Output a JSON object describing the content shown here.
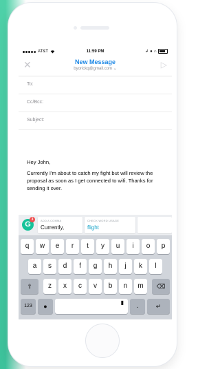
{
  "status_bar": {
    "carrier": "AT&T",
    "time": "11:59 PM"
  },
  "nav": {
    "title": "New Message",
    "from": "byorickq@gmail.com"
  },
  "fields": [
    {
      "label": "To:"
    },
    {
      "label": "Cc/Bcc:"
    },
    {
      "label": "Subject:"
    }
  ],
  "body": {
    "greeting": "Hey John,",
    "text": "Currently I'm about to catch my fight but will review the proposal as soon as I get connected to wifi. Thanks for sending it over."
  },
  "grammarly": {
    "badge_count": "3",
    "suggestions": [
      {
        "label": "ADD A COMMA",
        "value": "Currently,"
      },
      {
        "label": "CHECK WORD USAGE",
        "value": "flight"
      }
    ]
  },
  "keyboard": {
    "row1": [
      "q",
      "w",
      "e",
      "r",
      "t",
      "y",
      "u",
      "i",
      "o",
      "p"
    ],
    "row2": [
      "a",
      "s",
      "d",
      "f",
      "g",
      "h",
      "j",
      "k",
      "l"
    ],
    "row3": [
      "z",
      "x",
      "c",
      "v",
      "b",
      "n",
      "m"
    ],
    "numbers_key": "123",
    "period_key": "."
  },
  "colors": {
    "accent_blue": "#1e88e5",
    "grammarly_green": "#15c39a",
    "backdrop_teal": "#3dc29b"
  }
}
